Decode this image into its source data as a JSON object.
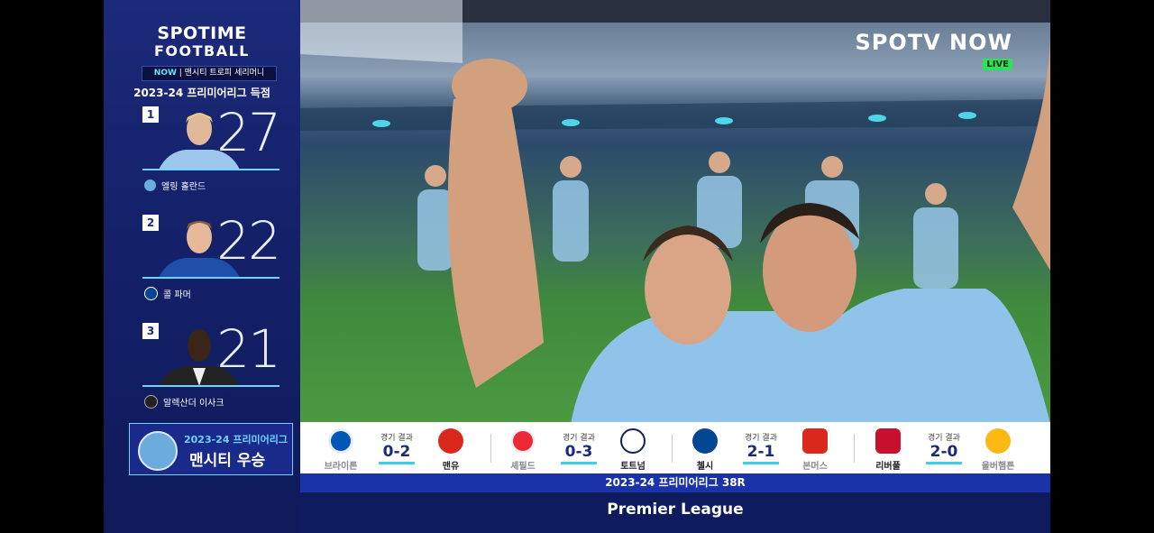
{
  "sidebar": {
    "brand_line1": "SPOTIME",
    "brand_line2": "FOOTBALL",
    "now_label": "NOW",
    "now_text": " | 맨시티 트로피 세리머니",
    "title": "2023-24 프리미어리그 득점",
    "players": [
      {
        "rank": "1",
        "goals": "27",
        "name": "엘링 홀란드",
        "club_color": "#6cabdd"
      },
      {
        "rank": "2",
        "goals": "22",
        "name": "콜 파머",
        "club_color": "#034694"
      },
      {
        "rank": "3",
        "goals": "21",
        "name": "알렉산더 이사크",
        "club_color": "#241f20"
      }
    ],
    "champion": {
      "line1": "2023-24 프리미어리그",
      "line2": "맨시티 우승"
    }
  },
  "video": {
    "logo": "SPOTV NOW",
    "live": "LIVE"
  },
  "results": {
    "score_label": "경기 결과",
    "matches": [
      {
        "home": "브라이튼",
        "home_color": "#0057b8",
        "score": "0-2",
        "away": "맨유",
        "away_color": "#da291c"
      },
      {
        "home": "셰필드",
        "home_color": "#ee2737",
        "score": "0-3",
        "away": "토트넘",
        "away_color": "#132257"
      },
      {
        "home": "첼시",
        "home_color": "#034694",
        "score": "2-1",
        "away": "본머스",
        "away_color": "#da291c"
      },
      {
        "home": "리버풀",
        "home_color": "#c8102e",
        "score": "2-0",
        "away": "울버햄튼",
        "away_color": "#fdb913"
      }
    ]
  },
  "round": "2023-24 프리미어리그 38R",
  "league": "Premier League"
}
